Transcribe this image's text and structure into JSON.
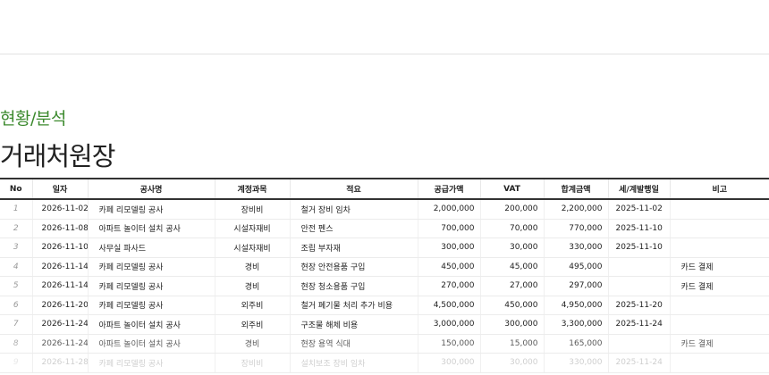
{
  "header": {
    "section": "현황/분석",
    "title": "거래처원장"
  },
  "table": {
    "columns": [
      "No",
      "일자",
      "공사명",
      "계정과목",
      "적요",
      "공급가액",
      "VAT",
      "합계금액",
      "세/계발행일",
      "비고"
    ],
    "rows": [
      [
        "1",
        "2026-11-02",
        "카페 리모델링 공사",
        "장비비",
        "철거 장비 임차",
        "2,000,000",
        "200,000",
        "2,200,000",
        "2025-11-02",
        ""
      ],
      [
        "2",
        "2026-11-08",
        "아파트 놀이터 설치 공사",
        "시설자재비",
        "안전 펜스",
        "700,000",
        "70,000",
        "770,000",
        "2025-11-10",
        ""
      ],
      [
        "3",
        "2026-11-10",
        "사무실 파사드",
        "시설자재비",
        "조립 부자재",
        "300,000",
        "30,000",
        "330,000",
        "2025-11-10",
        ""
      ],
      [
        "4",
        "2026-11-14",
        "카페 리모델링 공사",
        "경비",
        "현장 안전용품 구입",
        "450,000",
        "45,000",
        "495,000",
        "",
        "카드 결제"
      ],
      [
        "5",
        "2026-11-14",
        "카페 리모델링 공사",
        "경비",
        "현장 청소용품 구입",
        "270,000",
        "27,000",
        "297,000",
        "",
        "카드 결제"
      ],
      [
        "6",
        "2026-11-20",
        "카페 리모델링 공사",
        "외주비",
        "철거 폐기물 처리 추가 비용",
        "4,500,000",
        "450,000",
        "4,950,000",
        "2025-11-20",
        ""
      ],
      [
        "7",
        "2026-11-24",
        "아파트 놀이터 설치 공사",
        "외주비",
        "구조물 해체 비용",
        "3,000,000",
        "300,000",
        "3,300,000",
        "2025-11-24",
        ""
      ],
      [
        "8",
        "2026-11-24",
        "아파트 놀이터 설치 공사",
        "경비",
        "현장 용역 식대",
        "150,000",
        "15,000",
        "165,000",
        "",
        "카드 결제"
      ],
      [
        "9",
        "2026-11-28",
        "카페 리모델링 공사",
        "장비비",
        "설치보조 장비 임차",
        "300,000",
        "30,000",
        "330,000",
        "2025-11-24",
        ""
      ]
    ]
  }
}
